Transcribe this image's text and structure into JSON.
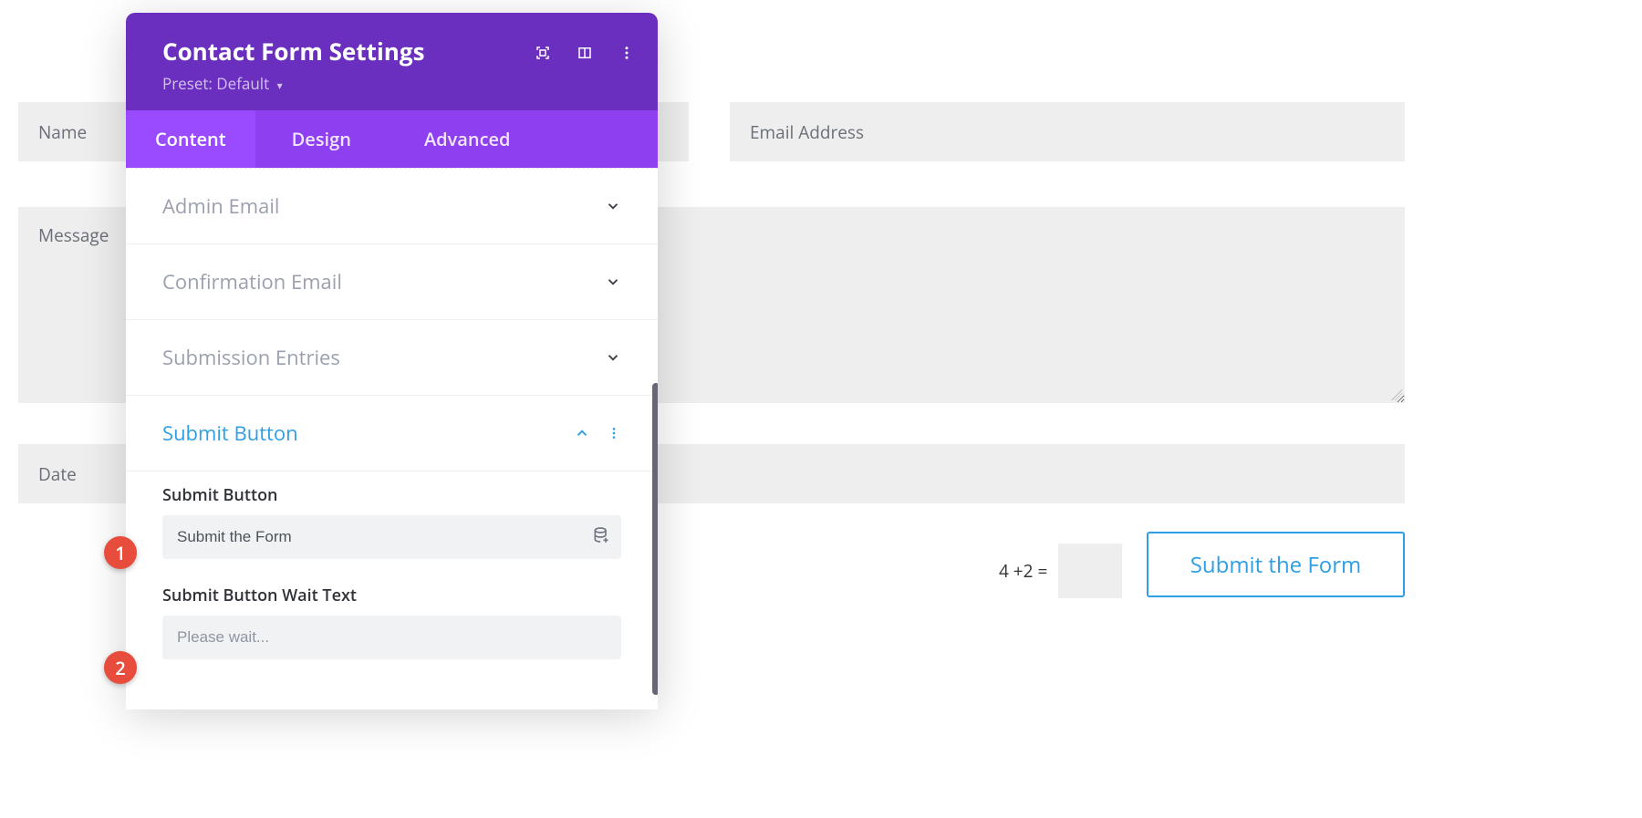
{
  "form": {
    "name_placeholder": "Name",
    "email_placeholder": "Email Address",
    "message_placeholder": "Message",
    "date_placeholder": "Date",
    "captcha_text": "4 +2 =",
    "submit_button_label": "Submit the Form"
  },
  "panel": {
    "title": "Contact Form Settings",
    "preset_label": "Preset: Default",
    "tabs": {
      "content": "Content",
      "design": "Design",
      "advanced": "Advanced"
    },
    "sections": {
      "admin_email": "Admin Email",
      "confirmation_email": "Confirmation Email",
      "submission_entries": "Submission Entries",
      "submit_button": "Submit Button"
    },
    "fields": {
      "submit_button_label": "Submit Button",
      "submit_button_value": "Submit the Form",
      "submit_button_wait_label": "Submit Button Wait Text",
      "submit_button_wait_placeholder": "Please wait..."
    }
  },
  "callouts": {
    "one": "1",
    "two": "2"
  },
  "colors": {
    "purple_header": "#6a2fbf",
    "purple_tabs": "#8e3ff0",
    "purple_active": "#9b4bff",
    "accent_blue": "#2e9ee5",
    "callout_red": "#e74c3c"
  }
}
